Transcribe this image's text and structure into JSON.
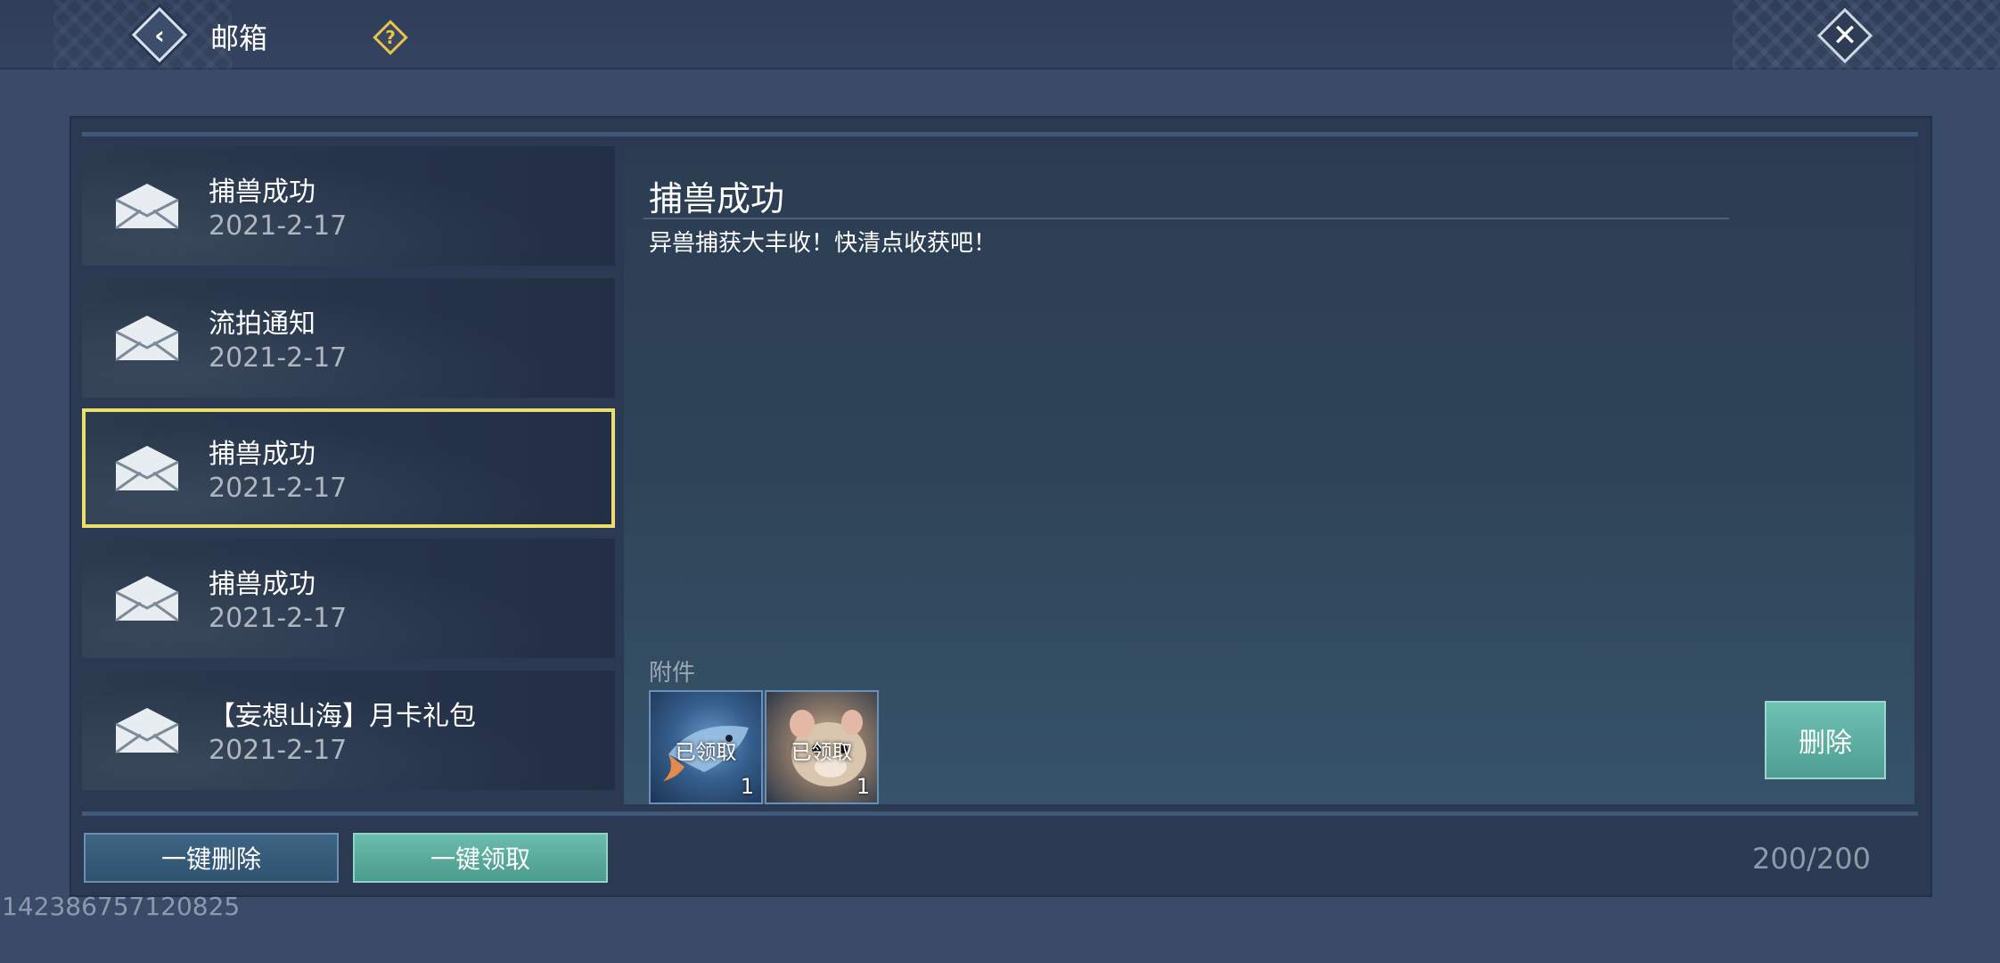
{
  "header": {
    "title": "邮箱",
    "help_label": "?",
    "back_glyph": "‹",
    "close_glyph": "✕"
  },
  "mail_list": [
    {
      "title": "捕兽成功",
      "date": "2021-2-17",
      "selected": false
    },
    {
      "title": "流拍通知",
      "date": "2021-2-17",
      "selected": false
    },
    {
      "title": "捕兽成功",
      "date": "2021-2-17",
      "selected": true
    },
    {
      "title": "捕兽成功",
      "date": "2021-2-17",
      "selected": false
    },
    {
      "title": "【妄想山海】月卡礼包",
      "date": "2021-2-17",
      "selected": false
    }
  ],
  "detail": {
    "title": "捕兽成功",
    "body": "异兽捕获大丰收！快清点收获吧！",
    "attachments_label": "附件",
    "attachments": [
      {
        "status": "已领取",
        "count": "1",
        "icon": "fish-item-icon"
      },
      {
        "status": "已领取",
        "count": "1",
        "icon": "hamster-item-icon"
      }
    ],
    "delete_label": "删除"
  },
  "footer": {
    "bulk_delete_label": "一键删除",
    "bulk_claim_label": "一键领取",
    "mail_count": "200/200"
  },
  "player_id": "142386757120825",
  "colors": {
    "selected_border": "#e9df6a",
    "accent_button": "#5fae9f",
    "help_icon": "#e8c448"
  }
}
